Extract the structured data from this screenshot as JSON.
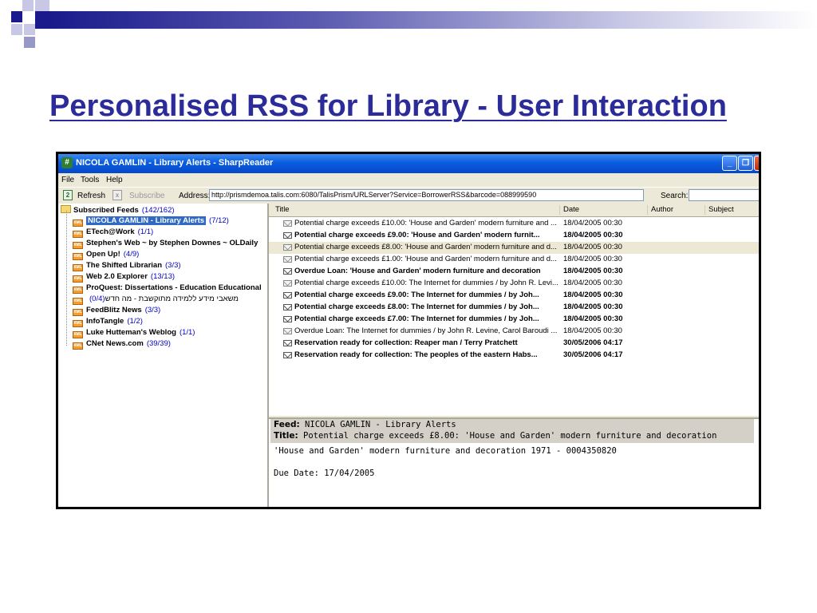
{
  "slide": {
    "title": "Personalised RSS for Library - User Interaction"
  },
  "window": {
    "title": "NICOLA GAMLIN - Library Alerts - SharpReader",
    "buttons": {
      "minimize": "_",
      "restore": "❐",
      "close": "×"
    }
  },
  "menu": [
    "File",
    "Tools",
    "Help"
  ],
  "toolbar": {
    "refresh_label": "Refresh",
    "subscribe_label": "Subscribe",
    "address_label": "Address:",
    "address_value": "http://prismdemoa.talis.com:6080/TalisPrism/URLServer?Service=BorrowerRSS&barcode=088999590",
    "search_label": "Search:",
    "search_value": ""
  },
  "feeds": {
    "root": {
      "label": "Subscribed Feeds",
      "count": "(142/162)"
    },
    "items": [
      {
        "label": "NICOLA GAMLIN - Library Alerts",
        "count": "(7/12)",
        "selected": true
      },
      {
        "label": "ETech@Work",
        "count": "(1/1)"
      },
      {
        "label": "Stephen's Web ~ by Stephen Downes ~ OLDaily",
        "count": ""
      },
      {
        "label": "Open Up!",
        "count": "(4/9)"
      },
      {
        "label": "The Shifted Librarian",
        "count": "(3/3)"
      },
      {
        "label": "Web 2.0 Explorer",
        "count": "(13/13)"
      },
      {
        "label": "ProQuest: Dissertations - Education Educational",
        "count": ""
      },
      {
        "label": "משאבי מידע ללמידה מתוקשבת - מה חדש",
        "count": "(0/4)"
      },
      {
        "label": "FeedBlitz News",
        "count": "(3/3)"
      },
      {
        "label": "InfoTangle",
        "count": "(1/2)"
      },
      {
        "label": "Luke Hutteman's Weblog",
        "count": "(1/1)"
      },
      {
        "label": "CNet News.com",
        "count": "(39/39)"
      }
    ]
  },
  "list": {
    "columns": {
      "title": "Title",
      "date": "Date",
      "author": "Author",
      "subject": "Subject"
    },
    "rows": [
      {
        "title": "Potential charge exceeds £10.00: 'House and Garden' modern furniture and ...",
        "date": "18/04/2005 00:30",
        "unread": false
      },
      {
        "title": "Potential charge exceeds £9.00: 'House and Garden' modern furnit...",
        "date": "18/04/2005 00:30",
        "unread": true
      },
      {
        "title": "Potential charge exceeds £8.00: 'House and Garden' modern furniture and d...",
        "date": "18/04/2005 00:30",
        "unread": false,
        "selected": true
      },
      {
        "title": "Potential charge exceeds £1.00: 'House and Garden' modern furniture and d...",
        "date": "18/04/2005 00:30",
        "unread": false
      },
      {
        "title": "Overdue Loan: 'House and Garden' modern furniture and decoration",
        "date": "18/04/2005 00:30",
        "unread": true
      },
      {
        "title": "Potential charge exceeds £10.00: The Internet for dummies / by John R. Levi...",
        "date": "18/04/2005 00:30",
        "unread": false
      },
      {
        "title": "Potential charge exceeds £9.00: The Internet for dummies / by Joh...",
        "date": "18/04/2005 00:30",
        "unread": true
      },
      {
        "title": "Potential charge exceeds £8.00: The Internet for dummies / by Joh...",
        "date": "18/04/2005 00:30",
        "unread": true
      },
      {
        "title": "Potential charge exceeds £7.00: The Internet for dummies / by Joh...",
        "date": "18/04/2005 00:30",
        "unread": true
      },
      {
        "title": "Overdue Loan: The Internet for dummies / by John R. Levine, Carol Baroudi ...",
        "date": "18/04/2005 00:30",
        "unread": false
      },
      {
        "title": "Reservation ready for collection: Reaper man / Terry Pratchett",
        "date": "30/05/2006 04:17",
        "unread": true
      },
      {
        "title": "Reservation ready for collection: The peoples of the eastern Habs...",
        "date": "30/05/2006 04:17",
        "unread": true
      }
    ]
  },
  "preview": {
    "feed_label": "Feed:",
    "feed_value": "NICOLA GAMLIN - Library Alerts",
    "title_label": "Title:",
    "title_value": "Potential charge exceeds £8.00: 'House and Garden' modern furniture and decoration",
    "line1": "'House and Garden' modern furniture and decoration 1971 - 0004350820",
    "line2": "Due Date: 17/04/2005"
  },
  "icons": {
    "app": "sharpreader-icon",
    "refresh": "refresh-icon",
    "subscribe": "rss-icon",
    "folder": "folder-icon",
    "feed": "xml-feed-icon",
    "envelope_unread": "envelope-icon",
    "envelope_read": "open-envelope-icon"
  },
  "colors": {
    "slide_title": "#2b2b9a",
    "titlebar": "#0a5ce0",
    "selection": "#316ac5",
    "count": "#0000c8"
  }
}
